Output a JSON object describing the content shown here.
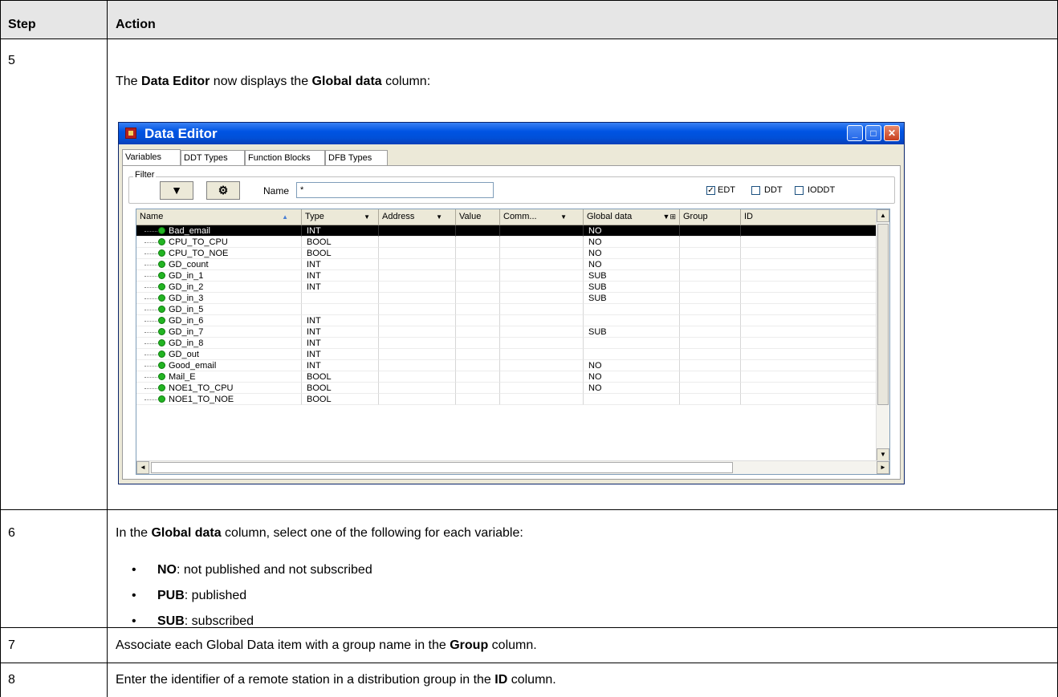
{
  "table": {
    "header": {
      "step": "Step",
      "action": "Action"
    },
    "rows": [
      {
        "step": "5",
        "intro_pre": "The ",
        "intro_b1": "Data Editor",
        "intro_mid": " now displays the ",
        "intro_b2": "Global data",
        "intro_post": " column:"
      },
      {
        "step": "6",
        "pre": "In the ",
        "b": "Global data",
        "post": " column, select one of the following for each variable:",
        "options": [
          {
            "key": "NO",
            "desc": ": not published and not subscribed"
          },
          {
            "key": "PUB",
            "desc": ": published"
          },
          {
            "key": "SUB",
            "desc": ": subscribed"
          }
        ]
      },
      {
        "step": "7",
        "pre": "Associate each Global Data item with a group name in the ",
        "b": "Group",
        "post": " column."
      },
      {
        "step": "8",
        "pre": "Enter the identifier of a remote station in a distribution group in the ",
        "b": "ID",
        "post": " column."
      }
    ]
  },
  "window": {
    "title": "Data Editor",
    "tabs": [
      "Variables",
      "DDT Types",
      "Function Blocks",
      "DFB Types"
    ],
    "filter": {
      "label": "Filter",
      "name_label": "Name",
      "name_value": "*",
      "checkboxes": [
        {
          "label": "EDT",
          "checked": true
        },
        {
          "label": "DDT",
          "checked": false
        },
        {
          "label": "IODDT",
          "checked": false
        }
      ]
    },
    "columns": [
      "Name",
      "Type",
      "Address",
      "Value",
      "Comm...",
      "Global data",
      "Group",
      "ID"
    ],
    "variables": [
      {
        "name": "Bad_email",
        "type": "INT",
        "global": "NO",
        "selected": true
      },
      {
        "name": "CPU_TO_CPU",
        "type": "BOOL",
        "global": "NO"
      },
      {
        "name": "CPU_TO_NOE",
        "type": "BOOL",
        "global": "NO"
      },
      {
        "name": "GD_count",
        "type": "INT",
        "global": "NO"
      },
      {
        "name": "GD_in_1",
        "type": "INT",
        "global": "SUB"
      },
      {
        "name": "GD_in_2",
        "type": "INT",
        "global": "SUB"
      },
      {
        "name": "GD_in_3",
        "type": "",
        "global": "SUB"
      },
      {
        "name": "GD_in_5",
        "type": "",
        "global": ""
      },
      {
        "name": "GD_in_6",
        "type": "INT",
        "global": ""
      },
      {
        "name": "GD_in_7",
        "type": "INT",
        "global": "SUB"
      },
      {
        "name": "GD_in_8",
        "type": "INT",
        "global": ""
      },
      {
        "name": "GD_out",
        "type": "INT",
        "global": ""
      },
      {
        "name": "Good_email",
        "type": "INT",
        "global": "NO"
      },
      {
        "name": "Mail_E",
        "type": "BOOL",
        "global": "NO"
      },
      {
        "name": "NOE1_TO_CPU",
        "type": "BOOL",
        "global": "NO"
      },
      {
        "name": "NOE1_TO_NOE",
        "type": "BOOL",
        "global": ""
      }
    ]
  }
}
